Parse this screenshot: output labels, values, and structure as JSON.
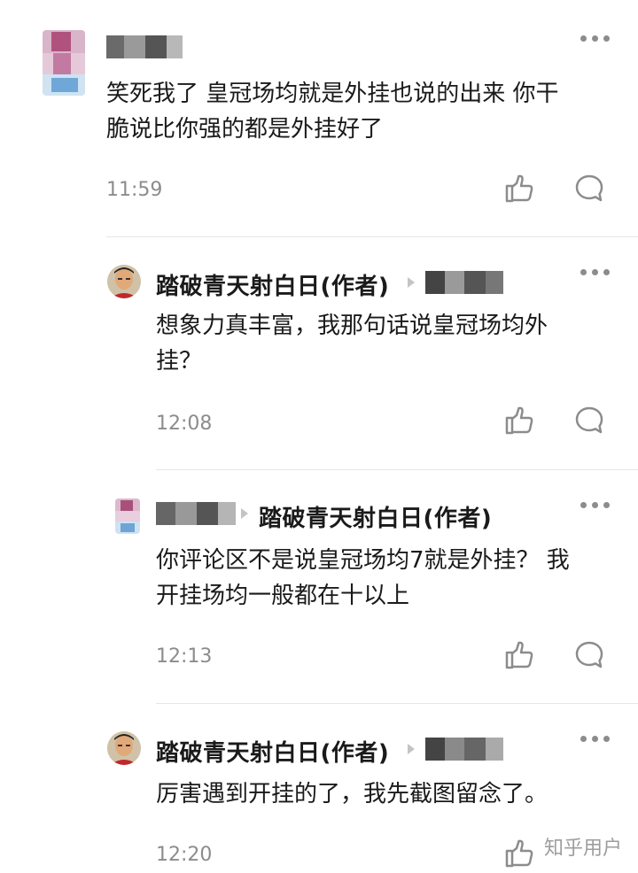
{
  "comments": [
    {
      "body": "笑死我了 皇冠场均就是外挂也说的出来 你干脆说比你强的都是外挂好了",
      "body_lines": [
        "笑死我了 皇冠场均就是外挂也说的出来 你干",
        "脆说比你强的都是外挂好了"
      ],
      "time": "11:59"
    },
    {
      "author": "踏破青天射白日(作者)",
      "body_lines": [
        "想象力真丰富，我那句话说皇冠场均外",
        "挂？"
      ],
      "time": "12:08"
    },
    {
      "reply_to": "踏破青天射白日(作者)",
      "body_lines": [
        "你评论区不是说皇冠场均7就是外挂？ 我",
        "开挂场均一般都在十以上"
      ],
      "time": "12:13"
    },
    {
      "author": "踏破青天射白日(作者)",
      "body_lines": [
        "厉害遇到开挂的了，我先截图留念了。"
      ],
      "time": "12:20"
    }
  ],
  "icons": {
    "more": "more-icon",
    "like": "thumbs-up-icon",
    "reply": "comment-bubble-icon"
  },
  "watermark": "知乎用户",
  "colors": {
    "text": "#1a1a1a",
    "secondary": "#8c8c8c",
    "divider": "#e6e6e6"
  }
}
